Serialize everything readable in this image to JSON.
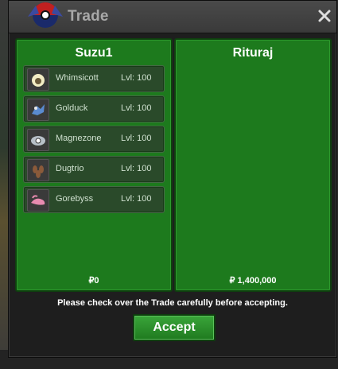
{
  "window": {
    "title": "Trade",
    "close_label": "✕"
  },
  "colors": {
    "panel": "#1d7a1d",
    "accent": "#3aa53a",
    "title_text": "#a8a8a8"
  },
  "left_panel": {
    "name": "Suzu1",
    "items": [
      {
        "name": "Whimsicott",
        "level": "Lvl: 100",
        "icon": "whimsicott-icon"
      },
      {
        "name": "Golduck",
        "level": "Lvl: 100",
        "icon": "golduck-icon"
      },
      {
        "name": "Magnezone",
        "level": "Lvl: 100",
        "icon": "magnezone-icon"
      },
      {
        "name": "Dugtrio",
        "level": "Lvl: 100",
        "icon": "dugtrio-icon"
      },
      {
        "name": "Gorebyss",
        "level": "Lvl: 100",
        "icon": "gorebyss-icon"
      }
    ],
    "money": "₽0"
  },
  "right_panel": {
    "name": "Rituraj",
    "items": [],
    "money": "₽ 1,400,000"
  },
  "notice": "Please check over the Trade carefully before accepting.",
  "accept_label": "Accept"
}
